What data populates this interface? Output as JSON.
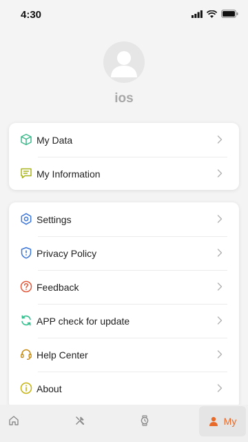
{
  "status_bar": {
    "time": "4:30"
  },
  "profile": {
    "username": "ios"
  },
  "menu_group_1": [
    {
      "label": "My Data",
      "icon": "cube-icon",
      "color": "#3cb88a"
    },
    {
      "label": "My Information",
      "icon": "message-icon",
      "color": "#a8b41c"
    }
  ],
  "menu_group_2": [
    {
      "label": "Settings",
      "icon": "gear-icon",
      "color": "#3b76d8"
    },
    {
      "label": "Privacy Policy",
      "icon": "shield-icon",
      "color": "#3b76d8"
    },
    {
      "label": "Feedback",
      "icon": "question-icon",
      "color": "#e1573a"
    },
    {
      "label": "APP check for update",
      "icon": "refresh-icon",
      "color": "#2fbf8c"
    },
    {
      "label": "Help Center",
      "icon": "headset-icon",
      "color": "#c88a10"
    },
    {
      "label": "About",
      "icon": "info-icon",
      "color": "#c4b20e"
    }
  ],
  "tab_bar": {
    "home_icon": "home-icon",
    "tools_icon": "tools-icon",
    "watch_icon": "watch-icon",
    "my_label": "My",
    "active_color": "#e86a2a"
  }
}
